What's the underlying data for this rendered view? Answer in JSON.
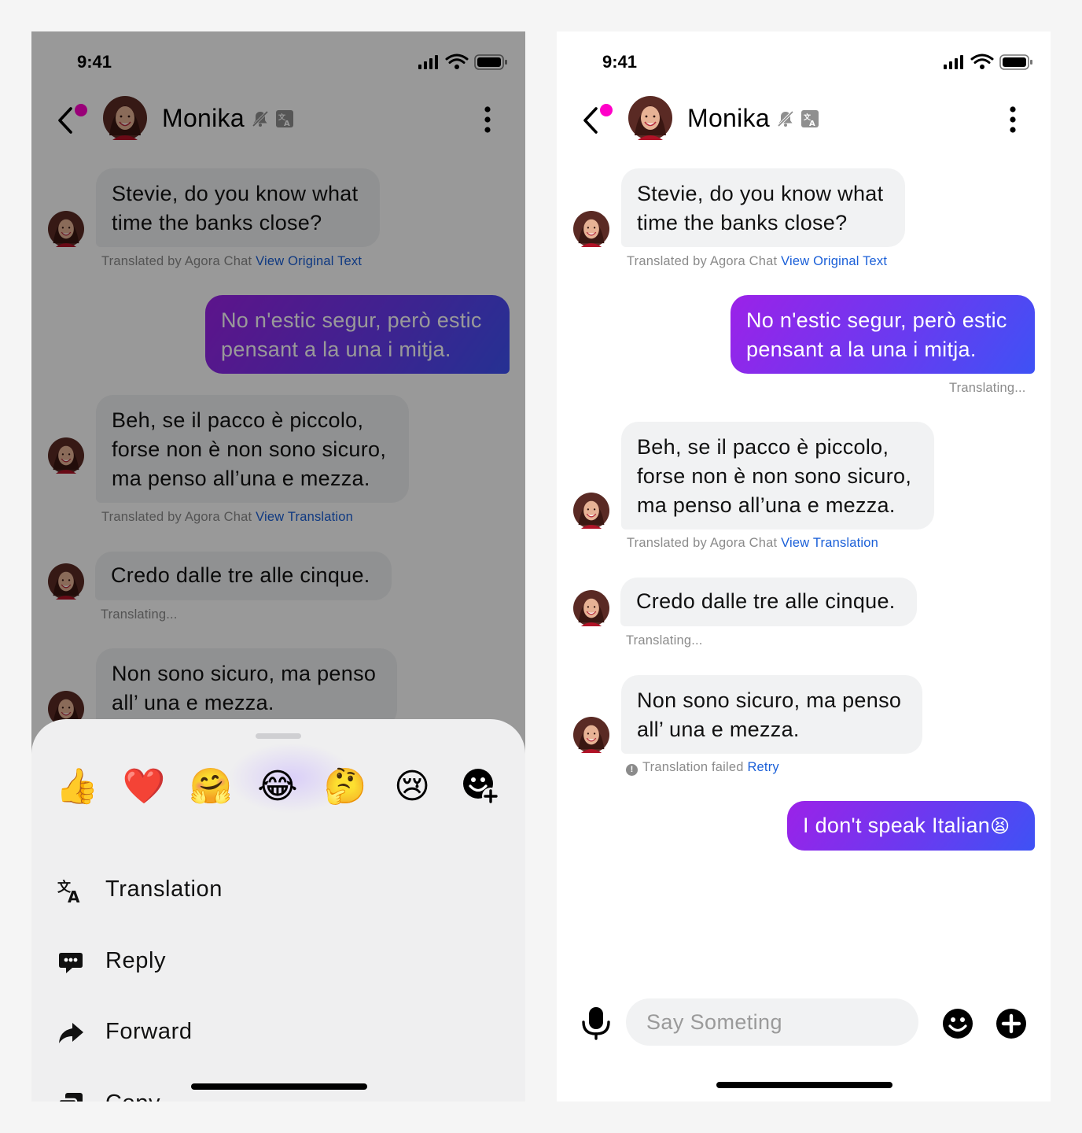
{
  "status": {
    "time": "9:41"
  },
  "header": {
    "name": "Monika"
  },
  "messages": {
    "m1": {
      "lines": [
        "Stevie, do you know what",
        "time the banks close?"
      ],
      "meta_prefix": "Translated by Agora Chat",
      "meta_link": "View Original Text"
    },
    "m2": {
      "lines": [
        "No n'estic segur, però estic",
        "pensant a la una i mitja."
      ],
      "meta": "Translating..."
    },
    "m3": {
      "lines": [
        "Beh, se il pacco è piccolo,",
        "forse non è non sono sicuro,",
        "ma penso all’una e mezza."
      ],
      "meta_prefix": "Translated by Agora Chat",
      "meta_link": "View Translation"
    },
    "m4": {
      "lines": [
        "Credo dalle tre alle cinque."
      ],
      "meta": "Translating..."
    },
    "m5": {
      "lines": [
        "Non sono sicuro, ma penso",
        "all’ una e mezza."
      ],
      "fail_text": "Translation failed",
      "fail_link": "Retry"
    },
    "m6": {
      "text": "I don't speak Italian",
      "emoji": "😫"
    }
  },
  "reactions": [
    "👍",
    "❤️",
    "🤗",
    "😂",
    "🤔",
    "😢"
  ],
  "menu": {
    "translation": "Translation",
    "reply": "Reply",
    "forward": "Forward",
    "copy": "Copy"
  },
  "composer": {
    "placeholder": "Say Someting"
  },
  "colors": {
    "accent_purple": "#9b22e8",
    "accent_blue": "#3e52f5",
    "link": "#1a5fd8",
    "status_dot": "#ff00c8"
  },
  "icons": {
    "back": "chevron-left-icon",
    "mute": "bell-off-icon",
    "translate": "translate-icon",
    "more": "more-vertical-icon",
    "add_reaction": "emoji-add-icon",
    "reply": "reply-icon",
    "forward": "forward-icon",
    "copy": "copy-icon",
    "mic": "mic-icon",
    "emoji": "emoji-icon",
    "plus": "plus-circle-icon"
  }
}
